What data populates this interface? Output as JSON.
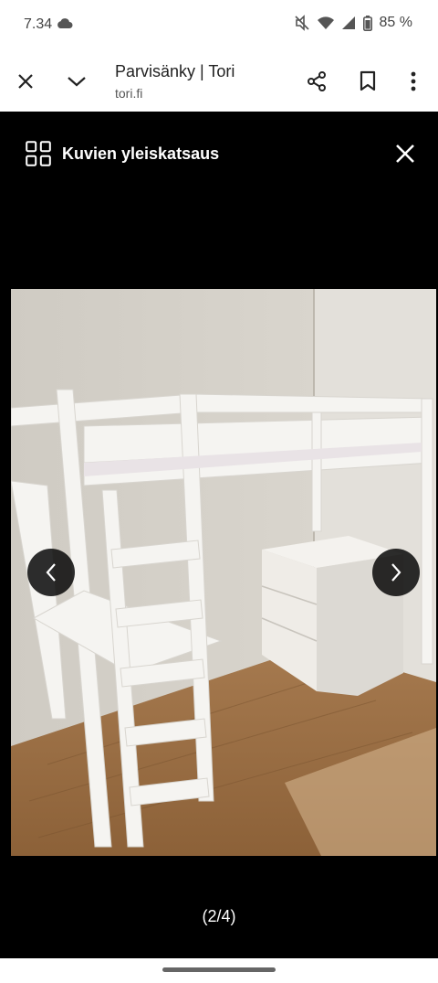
{
  "status_bar": {
    "time": "7.34",
    "battery": "85 %"
  },
  "toolbar": {
    "title": "Parvisänky | Tori",
    "url": "tori.fi"
  },
  "viewer": {
    "title": "Kuvien yleiskatsaus",
    "counter": "(2/4)"
  },
  "colors": {
    "viewer_bg": "#000000",
    "toolbar_bg": "#ffffff",
    "nav_button_bg": "#000000"
  },
  "icons": {
    "status": [
      "cloud-icon",
      "mute-icon",
      "wifi-icon",
      "signal-icon",
      "battery-icon"
    ],
    "toolbar": [
      "close-icon",
      "chevron-down-icon",
      "share-icon",
      "bookmark-icon",
      "more-vert-icon"
    ],
    "viewer": [
      "grid-icon",
      "close-icon",
      "chevron-left-icon",
      "chevron-right-icon"
    ]
  }
}
